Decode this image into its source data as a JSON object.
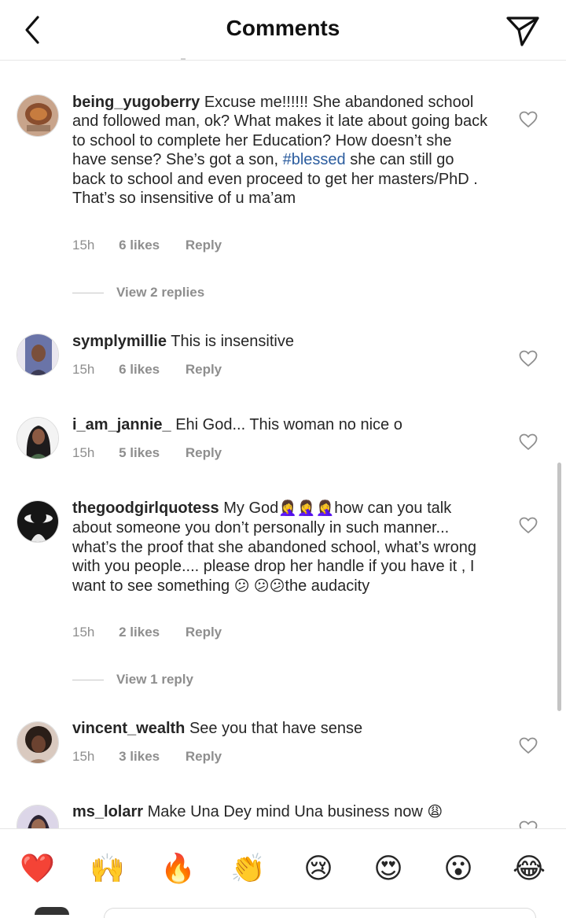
{
  "header": {
    "title": "Comments"
  },
  "comments": [
    {
      "username": "being_yugoberry",
      "text_before": "Excuse me!!!!!! She abandoned school and followed man, ok? What makes it late about going back to school to complete her Education? How doesn’t she have sense? She’s got a son, ",
      "hashtag": "#blessed",
      "text_after": " she can still go back to school and even proceed to get her masters/PhD . That’s so insensitive of u ma’am",
      "time": "15h",
      "likes": "6 likes",
      "reply": "Reply",
      "view_replies": "View 2 replies"
    },
    {
      "username": "symplymillie",
      "text": "This is insensitive",
      "time": "15h",
      "likes": "6 likes",
      "reply": "Reply"
    },
    {
      "username": "i_am_jannie_",
      "text": "Ehi God... This woman no nice o",
      "time": "15h",
      "likes": "5 likes",
      "reply": "Reply"
    },
    {
      "username": "thegoodgirlquotess",
      "text_1": "My God",
      "emoji_1": "🤦‍♀️🤦‍♀️🤦‍♀️",
      "text_2": "how can you talk about someone you don’t personally in such manner... what’s the proof that she abandoned school, what’s wrong with you people.... please drop her handle if you have it , I want to see something ",
      "emoji_2": "😕 😕😕",
      "text_3": "the audacity",
      "time": "15h",
      "likes": "2 likes",
      "reply": "Reply",
      "view_replies": "View 1 reply"
    },
    {
      "username": "vincent_wealth",
      "text": "See you that have sense",
      "time": "15h",
      "likes": "3 likes",
      "reply": "Reply"
    },
    {
      "username": "ms_lolarr",
      "text": "Make Una Dey mind Una business now",
      "emoji": "😩"
    }
  ],
  "reactions": [
    "❤️",
    "🙌",
    "🔥",
    "👏",
    "😢",
    "😍",
    "😮",
    "😂"
  ],
  "colors": {
    "hashtag": "#2b5c9e",
    "meta": "#8e8e8e",
    "text": "#262626"
  }
}
